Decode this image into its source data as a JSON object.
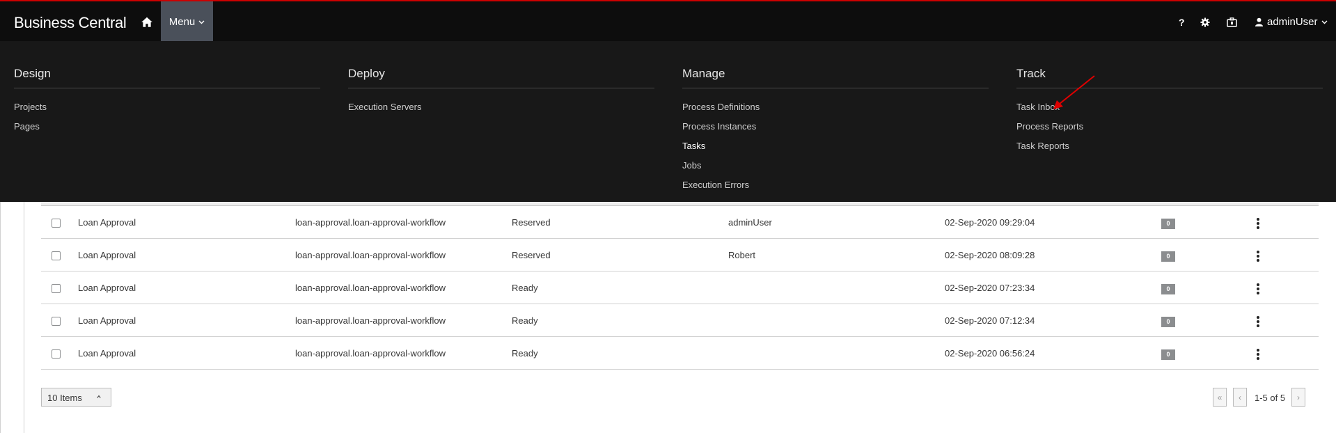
{
  "header": {
    "brand": "Business Central",
    "menu_label": "Menu",
    "help_label": "?",
    "user_label": "adminUser"
  },
  "megamenu": {
    "columns": [
      {
        "title": "Design",
        "items": [
          "Projects",
          "Pages"
        ]
      },
      {
        "title": "Deploy",
        "items": [
          "Execution Servers"
        ]
      },
      {
        "title": "Manage",
        "items": [
          "Process Definitions",
          "Process Instances",
          "Tasks",
          "Jobs",
          "Execution Errors"
        ]
      },
      {
        "title": "Track",
        "items": [
          "Task Inbox",
          "Process Reports",
          "Task Reports"
        ]
      }
    ]
  },
  "tasks": {
    "rows": [
      {
        "name": "Loan Approval",
        "definition": "loan-approval.loan-approval-workflow",
        "status": "Reserved",
        "owner": "adminUser",
        "created": "02-Sep-2020 09:29:04",
        "count": "0"
      },
      {
        "name": "Loan Approval",
        "definition": "loan-approval.loan-approval-workflow",
        "status": "Reserved",
        "owner": "Robert",
        "created": "02-Sep-2020 08:09:28",
        "count": "0"
      },
      {
        "name": "Loan Approval",
        "definition": "loan-approval.loan-approval-workflow",
        "status": "Ready",
        "owner": "",
        "created": "02-Sep-2020 07:23:34",
        "count": "0"
      },
      {
        "name": "Loan Approval",
        "definition": "loan-approval.loan-approval-workflow",
        "status": "Ready",
        "owner": "",
        "created": "02-Sep-2020 07:12:34",
        "count": "0"
      },
      {
        "name": "Loan Approval",
        "definition": "loan-approval.loan-approval-workflow",
        "status": "Ready",
        "owner": "",
        "created": "02-Sep-2020 06:56:24",
        "count": "0"
      }
    ]
  },
  "footer": {
    "page_size": "10 Items",
    "page_info": "1-5 of 5",
    "first_label": "«",
    "prev_label": "‹",
    "next_label": "›"
  },
  "colors": {
    "accent_border": "#cc0000",
    "annotation_arrow": "#e00000",
    "topbar_bg": "#0d0d0d",
    "menu_active_bg": "#4a505a"
  }
}
